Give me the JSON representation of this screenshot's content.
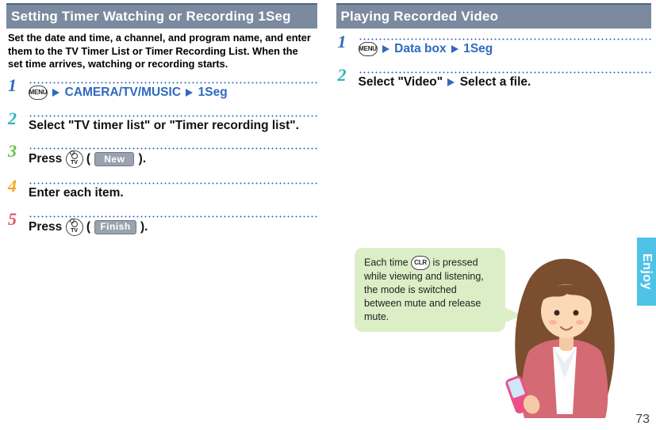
{
  "left": {
    "title": "Setting Timer Watching or Recording 1Seg",
    "intro": "Set the date and time, a channel, and program name, and enter them to the TV Timer List or Timer Recording List. When the set time arrives, watching or recording starts.",
    "steps": {
      "s1": {
        "menu": "MENU",
        "path1": "CAMERA/TV/MUSIC",
        "path2": "1Seg"
      },
      "s2": "Select \"TV timer list\" or \"Timer recording list\".",
      "s3": {
        "prefix": "Press ",
        "key_tv": "TV",
        "soft": "New",
        "open": "(",
        "close": ")."
      },
      "s4": "Enter each item.",
      "s5": {
        "prefix": "Press ",
        "key_tv": "TV",
        "soft": "Finish",
        "open": "(",
        "close": ")."
      }
    }
  },
  "right": {
    "title": "Playing Recorded Video",
    "steps": {
      "s1": {
        "menu": "MENU",
        "path1": "Data box",
        "path2": "1Seg"
      },
      "s2": {
        "a": "Select \"Video\"",
        "b": "Select a file."
      }
    }
  },
  "bubble": {
    "t1": "Each time ",
    "key": "CLR",
    "t2": " is pressed while viewing and listening, the mode is switched between mute and release mute."
  },
  "side_tab": "Enjoy",
  "page_number": "73"
}
